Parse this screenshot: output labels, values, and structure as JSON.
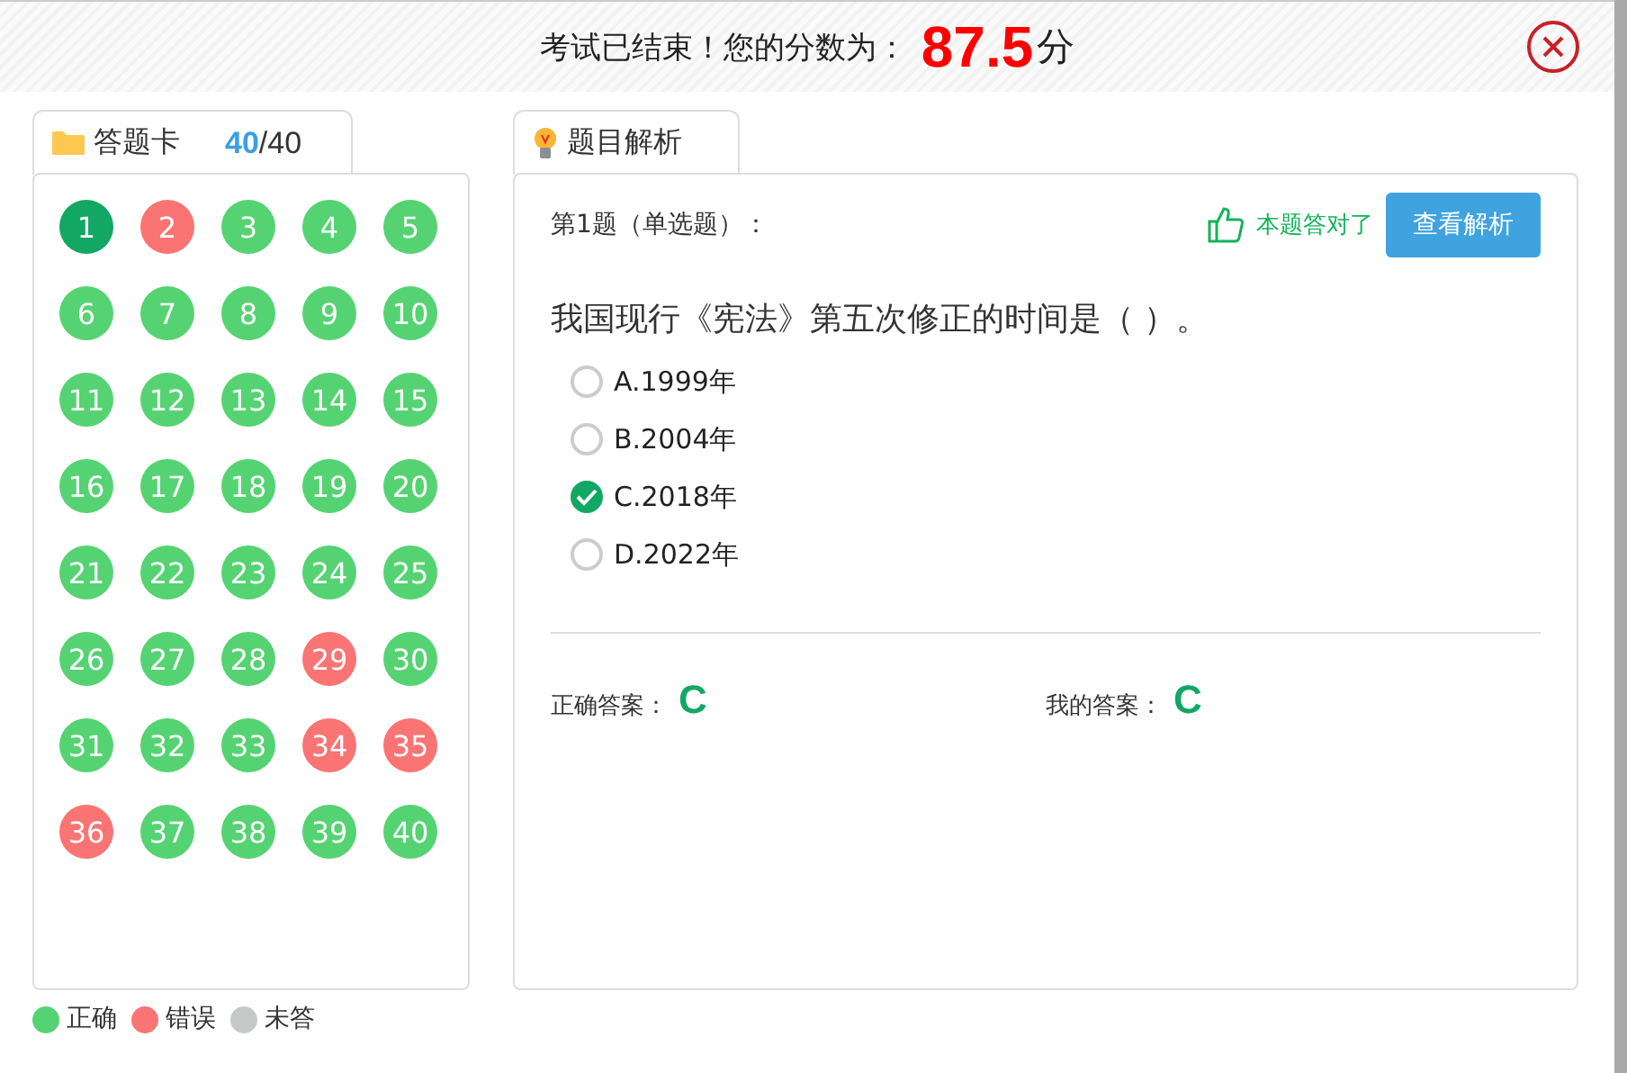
{
  "header": {
    "message": "考试已结束！您的分数为：",
    "score": "87.5",
    "unit": "分"
  },
  "answer_card": {
    "tab_label": "答题卡",
    "answered": "40",
    "total": "/40",
    "questions": [
      {
        "number": "1",
        "correct": true,
        "selected": true
      },
      {
        "number": "2",
        "correct": false,
        "selected": false
      },
      {
        "number": "3",
        "correct": true,
        "selected": false
      },
      {
        "number": "4",
        "correct": true,
        "selected": false
      },
      {
        "number": "5",
        "correct": true,
        "selected": false
      },
      {
        "number": "6",
        "correct": true,
        "selected": false
      },
      {
        "number": "7",
        "correct": true,
        "selected": false
      },
      {
        "number": "8",
        "correct": true,
        "selected": false
      },
      {
        "number": "9",
        "correct": true,
        "selected": false
      },
      {
        "number": "10",
        "correct": true,
        "selected": false
      },
      {
        "number": "11",
        "correct": true,
        "selected": false
      },
      {
        "number": "12",
        "correct": true,
        "selected": false
      },
      {
        "number": "13",
        "correct": true,
        "selected": false
      },
      {
        "number": "14",
        "correct": true,
        "selected": false
      },
      {
        "number": "15",
        "correct": true,
        "selected": false
      },
      {
        "number": "16",
        "correct": true,
        "selected": false
      },
      {
        "number": "17",
        "correct": true,
        "selected": false
      },
      {
        "number": "18",
        "correct": true,
        "selected": false
      },
      {
        "number": "19",
        "correct": true,
        "selected": false
      },
      {
        "number": "20",
        "correct": true,
        "selected": false
      },
      {
        "number": "21",
        "correct": true,
        "selected": false
      },
      {
        "number": "22",
        "correct": true,
        "selected": false
      },
      {
        "number": "23",
        "correct": true,
        "selected": false
      },
      {
        "number": "24",
        "correct": true,
        "selected": false
      },
      {
        "number": "25",
        "correct": true,
        "selected": false
      },
      {
        "number": "26",
        "correct": true,
        "selected": false
      },
      {
        "number": "27",
        "correct": true,
        "selected": false
      },
      {
        "number": "28",
        "correct": true,
        "selected": false
      },
      {
        "number": "29",
        "correct": false,
        "selected": false
      },
      {
        "number": "30",
        "correct": true,
        "selected": false
      },
      {
        "number": "31",
        "correct": true,
        "selected": false
      },
      {
        "number": "32",
        "correct": true,
        "selected": false
      },
      {
        "number": "33",
        "correct": true,
        "selected": false
      },
      {
        "number": "34",
        "correct": false,
        "selected": false
      },
      {
        "number": "35",
        "correct": false,
        "selected": false
      },
      {
        "number": "36",
        "correct": false,
        "selected": false
      },
      {
        "number": "37",
        "correct": true,
        "selected": false
      },
      {
        "number": "38",
        "correct": true,
        "selected": false
      },
      {
        "number": "39",
        "correct": true,
        "selected": false
      },
      {
        "number": "40",
        "correct": true,
        "selected": false
      }
    ]
  },
  "legend": [
    {
      "label": "正确",
      "color": "#55d372"
    },
    {
      "label": "错误",
      "color": "#fa7474"
    },
    {
      "label": "未答",
      "color": "#c4c9c7"
    }
  ],
  "analysis": {
    "tab_label": "题目解析",
    "question_type": "第1题（单选题）：",
    "result": "本题答对了",
    "view_button": "查看解析",
    "question": "我国现行《宪法》第五次修正的时间是（ ）。",
    "options": [
      {
        "label": "A.1999年",
        "checked": false
      },
      {
        "label": "B.2004年",
        "checked": false
      },
      {
        "label": "C.2018年",
        "checked": true
      },
      {
        "label": "D.2022年",
        "checked": false
      }
    ],
    "correct_answer_label": "正确答案：",
    "correct_answer": "C",
    "my_answer_label": "我的答案：",
    "my_answer": "C"
  }
}
